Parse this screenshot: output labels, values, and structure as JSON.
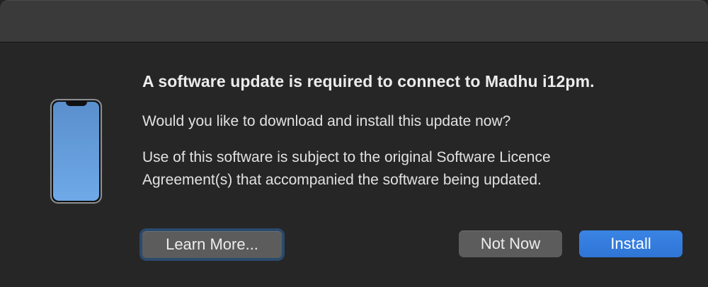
{
  "dialog": {
    "title": "A software update is required to connect to Madhu i12pm.",
    "question": "Would you like to download and install this update now?",
    "licence_line_1": "Use of this software is subject to the original Software Licence",
    "licence_line_2": "Agreement(s) that accompanied the software being updated."
  },
  "buttons": {
    "learn_more": "Learn More...",
    "not_now": "Not Now",
    "install": "Install"
  },
  "icons": {
    "device": "iphone-icon"
  },
  "colors": {
    "accent": "#3a84e4",
    "focus_ring": "#2b4a6d",
    "phone_screen": "#6fa9e8"
  }
}
